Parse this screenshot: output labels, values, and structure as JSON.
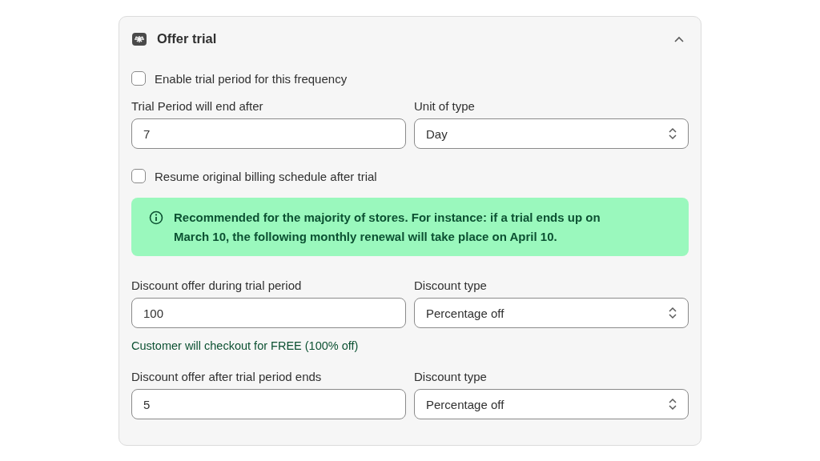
{
  "card": {
    "title": "Offer trial",
    "expanded": true,
    "items": [
      {
        "kind": "checkbox",
        "label": "Enable trial period for this frequency",
        "checked": false
      },
      {
        "kind": "fields",
        "fields": [
          {
            "kind": "input",
            "label": "Trial Period will end after",
            "value": "7"
          },
          {
            "kind": "select",
            "label": "Unit of type",
            "value": "Day"
          }
        ]
      },
      {
        "kind": "checkbox",
        "label": "Resume original billing schedule after trial",
        "checked": false
      },
      {
        "kind": "banner",
        "text": "Recommended for the majority of stores. For instance: if a trial ends up on March 10, the following monthly renewal will take place on April 10."
      },
      {
        "kind": "fields",
        "fields": [
          {
            "kind": "input",
            "label": "Discount offer during trial period",
            "value": "100"
          },
          {
            "kind": "select",
            "label": "Discount type",
            "value": "Percentage off"
          }
        ]
      },
      {
        "kind": "help",
        "text": "Customer will checkout for FREE (100% off)"
      },
      {
        "kind": "fields",
        "fields": [
          {
            "kind": "input",
            "label": "Discount offer after trial period ends",
            "value": "5"
          },
          {
            "kind": "select",
            "label": "Discount type",
            "value": "Percentage off"
          }
        ]
      }
    ]
  }
}
